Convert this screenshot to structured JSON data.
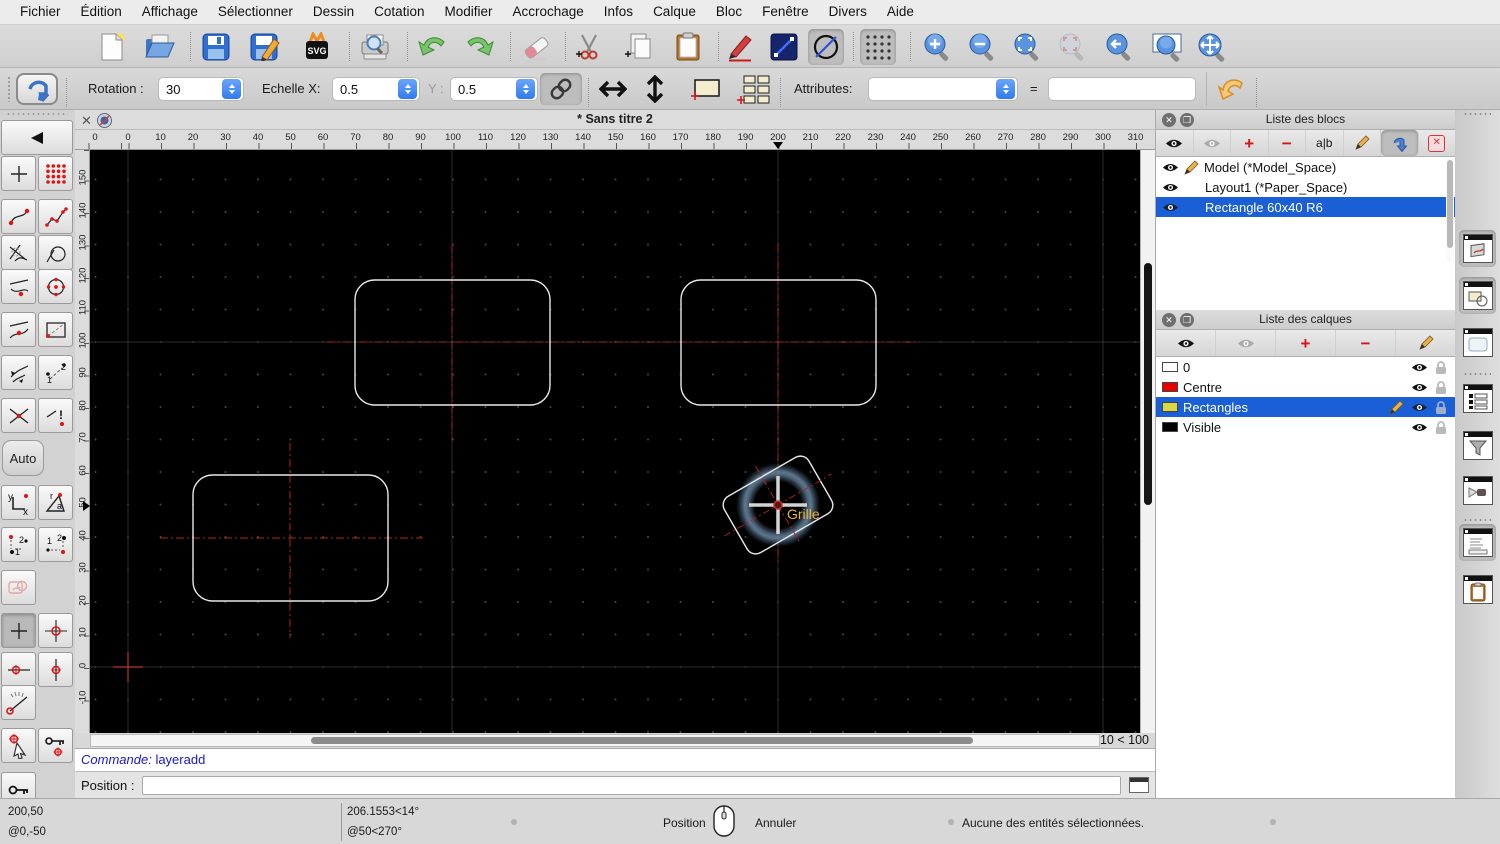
{
  "menu": {
    "items": [
      "Fichier",
      "Édition",
      "Affichage",
      "Sélectionner",
      "Dessin",
      "Cotation",
      "Modifier",
      "Accrochage",
      "Infos",
      "Calque",
      "Bloc",
      "Fenêtre",
      "Divers",
      "Aide"
    ]
  },
  "toolbar1": {
    "svg_label": "SVG"
  },
  "toolbar2": {
    "rotation_label": "Rotation :",
    "rotation_value": "30",
    "scale_x_label": "Echelle X:",
    "scale_x_value": "0.5",
    "scale_y_label": "Y :",
    "scale_y_value": "0.5",
    "attributes_label": "Attributes:",
    "equals": "=",
    "attributes_value": "",
    "attributes_input_value": ""
  },
  "doc": {
    "title": "* Sans titre 2",
    "close_glyph": "✕"
  },
  "canvas": {
    "corner_label": "0",
    "h_ruler_labels": [
      "0",
      "10",
      "20",
      "30",
      "40",
      "50",
      "60",
      "70",
      "80",
      "90",
      "100",
      "110",
      "120",
      "130",
      "140",
      "150",
      "160",
      "170",
      "180",
      "190",
      "200",
      "210",
      "220",
      "230",
      "240",
      "250",
      "260",
      "270",
      "280",
      "290",
      "300",
      "310"
    ],
    "v_ruler_labels": [
      "150",
      "140",
      "130",
      "120",
      "110",
      "100",
      "90",
      "80",
      "70",
      "60",
      "50",
      "40",
      "30",
      "20",
      "10",
      "0",
      "-10"
    ],
    "snap_tooltip": "Grille",
    "zoom_indicator": "10 < 100",
    "accent_red": "#b62020",
    "entity_color": "#e8e8e8",
    "snap_glow_color": "#5d7890",
    "tooltip_color": "#eab33e"
  },
  "left_palette": {
    "auto_label": "Auto"
  },
  "panels": {
    "blocks": {
      "title": "Liste des blocs",
      "ab_label": "a|b",
      "plus_label": "+",
      "minus_label": "−",
      "xbox_label": "✕",
      "items": [
        {
          "label": "Model (*Model_Space)",
          "editable": true,
          "selected": false
        },
        {
          "label": "Layout1 (*Paper_Space)",
          "editable": false,
          "selected": false
        },
        {
          "label": "Rectangle 60x40 R6",
          "editable": false,
          "selected": true
        }
      ]
    },
    "layers": {
      "title": "Liste des calques",
      "plus_label": "+",
      "minus_label": "−",
      "items": [
        {
          "label": "0",
          "color": "#ffffff",
          "editable": false,
          "selected": false
        },
        {
          "label": "Centre",
          "color": "#e60000",
          "editable": false,
          "selected": false
        },
        {
          "label": "Rectangles",
          "color": "#d9d943",
          "editable": true,
          "selected": true
        },
        {
          "label": "Visible",
          "color": "#000000",
          "editable": false,
          "selected": false
        }
      ]
    },
    "selection_blue": "#1a5fd6"
  },
  "command": {
    "prompt": "Commande:",
    "value": "layeradd",
    "position_label": "Position :",
    "position_value": ""
  },
  "statusbar": {
    "coord_abs": "200,50",
    "coord_rel": "@0,-50",
    "polar_abs": "206.1553<14°",
    "polar_rel": "@50<270°",
    "left_button_label": "Position",
    "right_button_label": "Annuler",
    "selection_status": "Aucune des entités sélectionnées."
  }
}
